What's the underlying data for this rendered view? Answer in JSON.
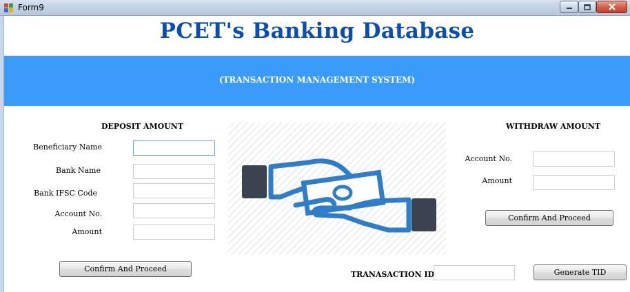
{
  "window": {
    "title": "Form9"
  },
  "header": {
    "title": "PCET's Banking Database",
    "subtitle": "(TRANSACTION MANAGEMENT SYSTEM)"
  },
  "deposit": {
    "heading": "DEPOSIT AMOUNT",
    "fields": [
      {
        "label": "Beneficiary Name",
        "value": ""
      },
      {
        "label": "Bank Name",
        "value": ""
      },
      {
        "label": "Bank IFSC Code",
        "value": ""
      },
      {
        "label": "Account No.",
        "value": ""
      },
      {
        "label": "Amount",
        "value": ""
      }
    ],
    "button_label": "Confirm And Proceed"
  },
  "withdraw": {
    "heading": "WITHDRAW AMOUNT",
    "fields": [
      {
        "label": "Account No.",
        "value": ""
      },
      {
        "label": "Amount",
        "value": ""
      }
    ],
    "button_label": "Confirm And Proceed"
  },
  "transaction": {
    "label": "TRANASACTION ID",
    "value": "",
    "button_label": "Generate TID"
  },
  "colors": {
    "banner": "#3b9bfa",
    "heading": "#0a4fb0",
    "illustration_blue": "#2f7dc9",
    "illustration_dark": "#3a424d"
  },
  "icons": {
    "window_icon": "app-window-icon",
    "illustration": "money-transfer-hands-icon"
  }
}
